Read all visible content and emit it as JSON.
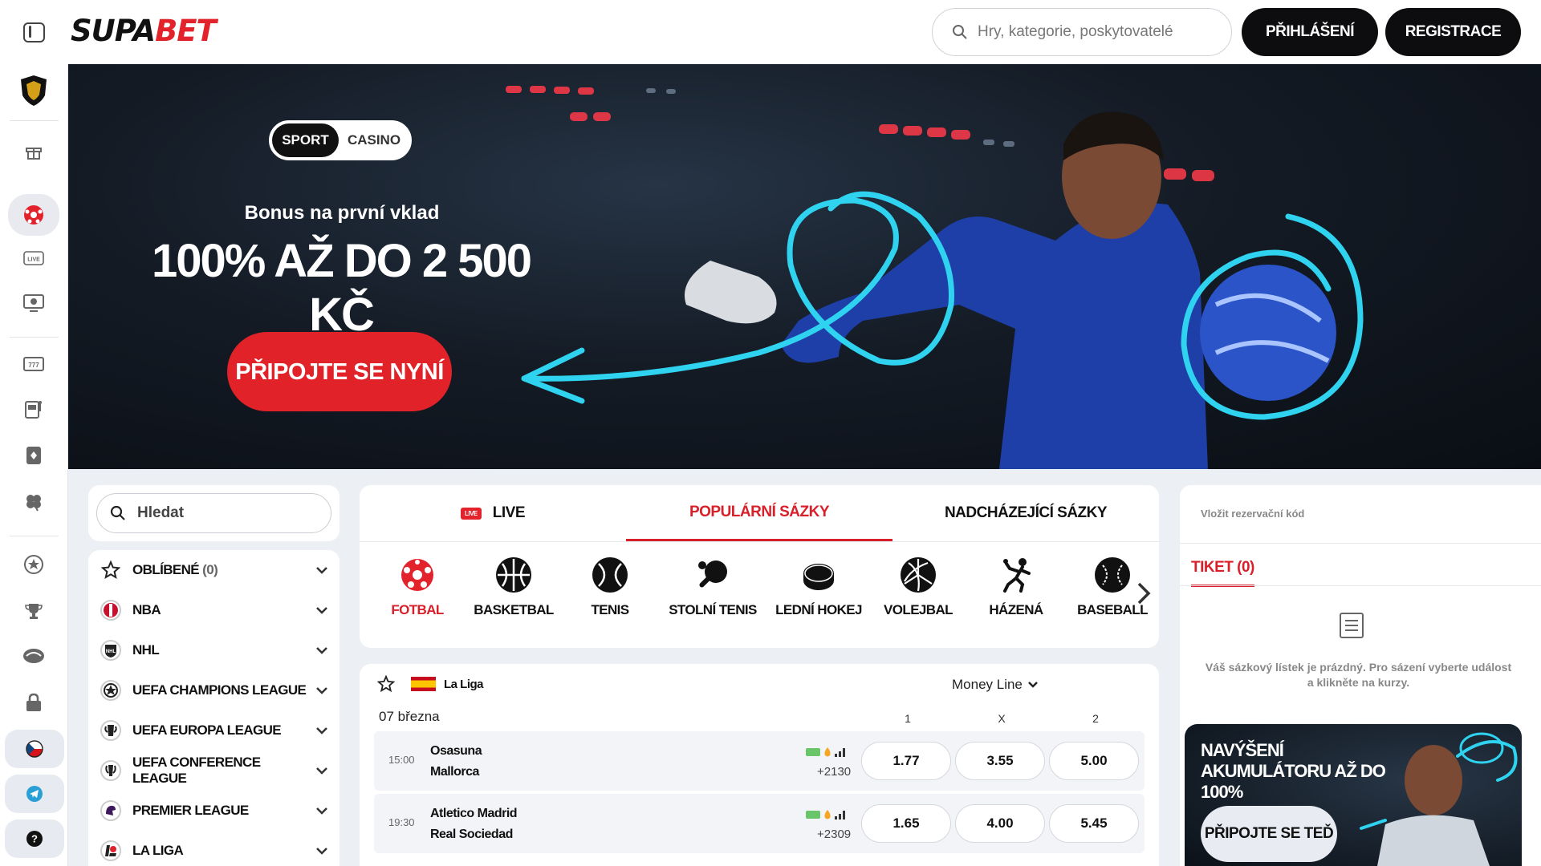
{
  "header": {
    "logo_part1": "SUPA",
    "logo_part2": "BET",
    "search_placeholder": "Hry, kategorie, poskytovatelé",
    "login_label": "PŘIHLÁŠENÍ",
    "register_label": "REGISTRACE"
  },
  "hero": {
    "toggle_sport": "SPORT",
    "toggle_casino": "CASINO",
    "subtitle": "Bonus na první vklad",
    "title": "100% AŽ DO 2 500 KČ",
    "cta": "PŘIPOJTE SE NYNÍ"
  },
  "left_panel": {
    "search_placeholder": "Hledat",
    "favorites_label": "OBLÍBENÉ",
    "favorites_count": "(0)",
    "leagues": [
      "NBA",
      "NHL",
      "UEFA CHAMPIONS LEAGUE",
      "UEFA EUROPA LEAGUE",
      "UEFA CONFERENCE LEAGUE",
      "PREMIER LEAGUE",
      "LA LIGA"
    ]
  },
  "tabs": {
    "live_badge": "LIVE",
    "live": "LIVE",
    "popular": "POPULÁRNÍ SÁZKY",
    "upcoming": "NADCHÁZEJÍCÍ SÁZKY"
  },
  "sports": [
    "FOTBAL",
    "BASKETBAL",
    "TENIS",
    "STOLNÍ TENIS",
    "LEDNÍ HOKEJ",
    "VOLEJBAL",
    "HÁZENÁ",
    "BASEBALL"
  ],
  "events": {
    "league": "La Liga",
    "market": "Money Line",
    "date": "07 března",
    "col1": "1",
    "colx": "X",
    "col2": "2",
    "rows": [
      {
        "time": "15:00",
        "home": "Osasuna",
        "away": "Mallorca",
        "more": "+2130",
        "o1": "1.77",
        "ox": "3.55",
        "o2": "5.00"
      },
      {
        "time": "19:30",
        "home": "Atletico Madrid",
        "away": "Real Sociedad",
        "more": "+2309",
        "o1": "1.65",
        "ox": "4.00",
        "o2": "5.45"
      }
    ]
  },
  "betslip": {
    "reservation_placeholder": "Vložit rezervační kód",
    "ticket_label": "TIKET (0)",
    "empty_text": "Váš sázkový lístek je prázdný. Pro sázení vyberte událost a klikněte na kurzy.",
    "promo_title": "NAVÝŠENÍ AKUMULÁTORU AŽ DO 100%",
    "promo_button": "PŘIPOJTE SE TEĎ"
  },
  "colors": {
    "brand_red": "#e3232c",
    "dark": "#0d0d0f",
    "accent_cyan": "#2fd3f0"
  }
}
